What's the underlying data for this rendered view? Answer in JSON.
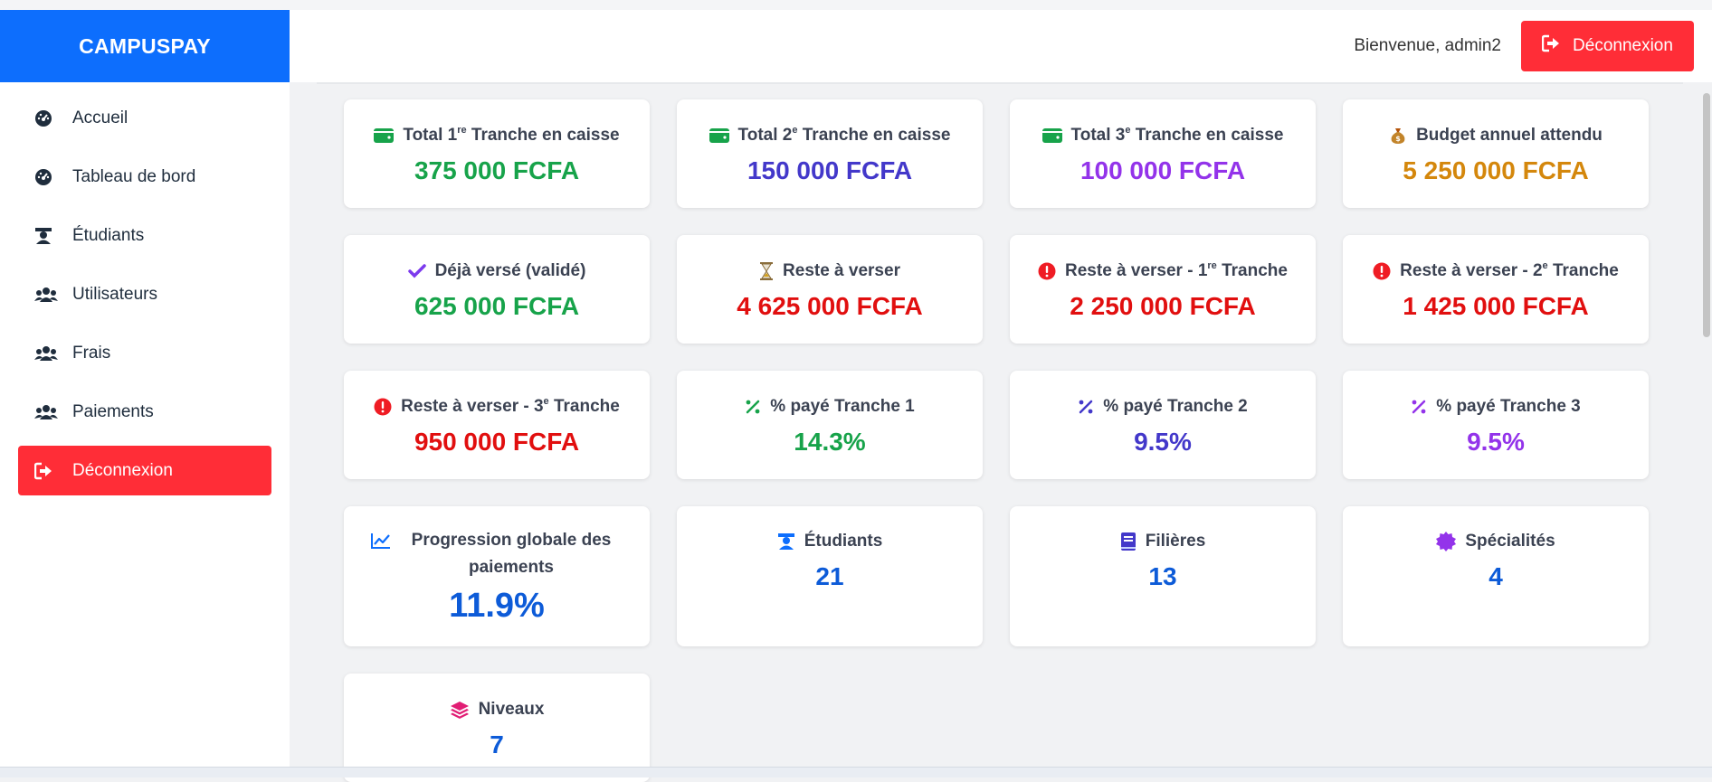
{
  "app": {
    "brand": "CAMPUSPAY"
  },
  "sidebar": {
    "items": [
      {
        "label": "Accueil",
        "icon": "gauge-icon"
      },
      {
        "label": "Tableau de bord",
        "icon": "gauge-icon"
      },
      {
        "label": "Étudiants",
        "icon": "graduate-icon"
      },
      {
        "label": "Utilisateurs",
        "icon": "users-icon"
      },
      {
        "label": "Frais",
        "icon": "users-icon"
      },
      {
        "label": "Paiements",
        "icon": "users-icon"
      },
      {
        "label": "Déconnexion",
        "icon": "logout-icon"
      }
    ]
  },
  "header": {
    "welcome": "Bienvenue, admin2",
    "logout_label": "Déconnexion"
  },
  "cards": {
    "t1_total": {
      "pre": "Total 1",
      "sup": "re",
      "post": " Tranche en caisse",
      "value": "375 000 FCFA"
    },
    "t2_total": {
      "pre": "Total 2",
      "sup": "e",
      "post": " Tranche en caisse",
      "value": "150 000 FCFA"
    },
    "t3_total": {
      "pre": "Total 3",
      "sup": "e",
      "post": " Tranche en caisse",
      "value": "100 000 FCFA"
    },
    "budget": {
      "title": "Budget annuel attendu",
      "value": "5 250 000 FCFA"
    },
    "paid": {
      "title": "Déjà versé (validé)",
      "value": "625 000 FCFA"
    },
    "remaining": {
      "title": "Reste à verser",
      "value": "4 625 000 FCFA"
    },
    "remaining_t1": {
      "pre": "Reste à verser - 1",
      "sup": "re",
      "post": " Tranche",
      "value": "2 250 000 FCFA"
    },
    "remaining_t2": {
      "pre": "Reste à verser - 2",
      "sup": "e",
      "post": " Tranche",
      "value": "1 425 000 FCFA"
    },
    "remaining_t3": {
      "pre": "Reste à verser - 3",
      "sup": "e",
      "post": " Tranche",
      "value": "950 000 FCFA"
    },
    "pct_t1": {
      "title": "% payé Tranche 1",
      "value": "14.3%"
    },
    "pct_t2": {
      "title": "% payé Tranche 2",
      "value": "9.5%"
    },
    "pct_t3": {
      "title": "% payé Tranche 3",
      "value": "9.5%"
    },
    "progress": {
      "title": "Progression globale des paiements",
      "value": "11.9%"
    },
    "students": {
      "title": "Étudiants",
      "value": "21"
    },
    "fields": {
      "title": "Filières",
      "value": "13"
    },
    "specialties": {
      "title": "Spécialités",
      "value": "4"
    },
    "levels": {
      "title": "Niveaux",
      "value": "7"
    }
  },
  "colors": {
    "brand": "#0d6efd",
    "danger": "#ff2d37",
    "green": "#17a34a",
    "indigo": "#4338ca",
    "purple": "#9333ea",
    "orange": "#d4870c",
    "red": "#e10f0f",
    "blue": "#0d5bd8"
  }
}
